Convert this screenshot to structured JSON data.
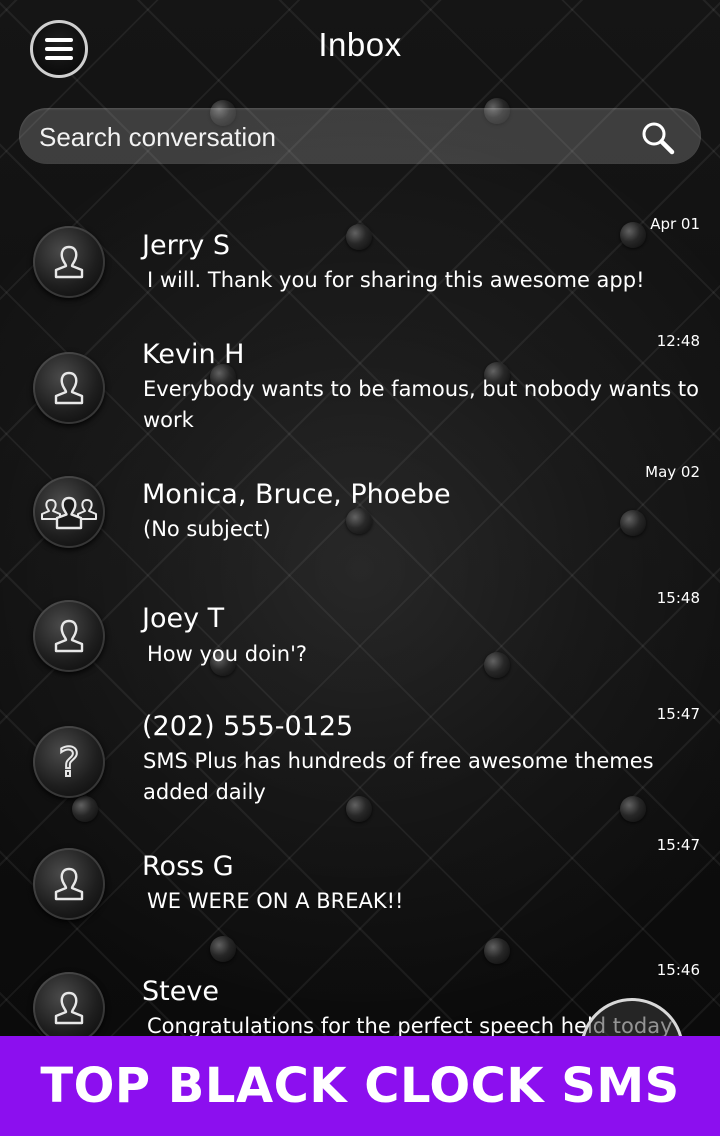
{
  "header": {
    "title": "Inbox",
    "menu_icon": "hamburger-menu-icon"
  },
  "search": {
    "placeholder": "Search conversation",
    "icon": "search-icon"
  },
  "conversations": [
    {
      "name": "Jerry S",
      "preview": "I will. Thank you for sharing this awesome app!",
      "time": "Apr 01",
      "avatar": "single-person-icon"
    },
    {
      "name": "Kevin H",
      "preview": " Everybody wants to be famous, but nobody wants to work",
      "time": "12:48",
      "avatar": "single-person-icon"
    },
    {
      "name": "Monica, Bruce, Phoebe",
      "preview": "(No subject)",
      "time": "May 02",
      "avatar": "group-people-icon"
    },
    {
      "name": "Joey T",
      "preview": "How you doin'?",
      "time": "15:48",
      "avatar": "single-person-icon"
    },
    {
      "name": "(202) 555-0125",
      "preview": "SMS Plus has hundreds of free awesome themes added daily",
      "time": "15:47",
      "avatar": "question-mark-icon"
    },
    {
      "name": "Ross G",
      "preview": "WE WERE ON A BREAK!!",
      "time": "15:47",
      "avatar": "single-person-icon"
    },
    {
      "name": "Steve",
      "preview": "Congratulations for the perfect speech held today",
      "time": "15:46",
      "avatar": "single-person-icon"
    }
  ],
  "banner": {
    "text": "TOP BLACK CLOCK SMS",
    "color": "#8c0fef"
  }
}
